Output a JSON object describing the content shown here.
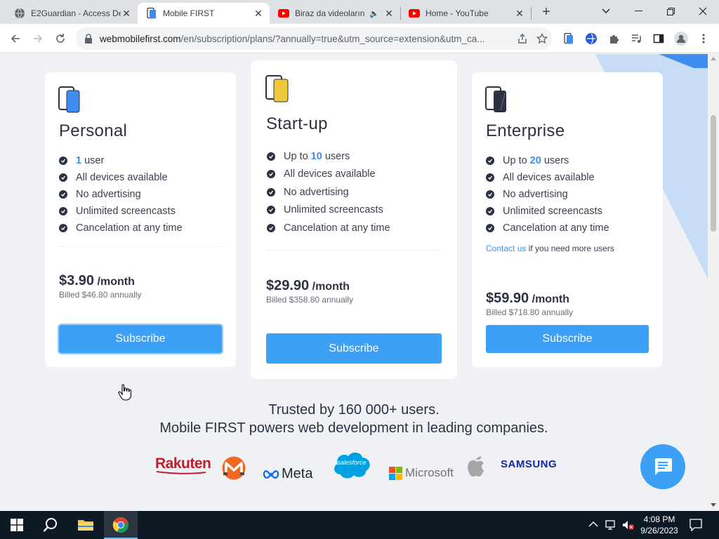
{
  "browser": {
    "tabs": [
      {
        "title": "E2Guardian - Access De",
        "favicon": "globe-icon",
        "active": false
      },
      {
        "title": "Mobile FIRST",
        "favicon": "mobile-first-icon",
        "active": true
      },
      {
        "title": "Biraz da videoların",
        "favicon": "youtube-icon",
        "active": false,
        "audio": true
      },
      {
        "title": "Home - YouTube",
        "favicon": "youtube-icon",
        "active": false
      }
    ],
    "url_host": "webmobilefirst.com",
    "url_path": "/en/subscription/plans/?annually=true&utm_source=extension&utm_ca..."
  },
  "plans": [
    {
      "name": "Personal",
      "icon_color": "#3d8ef0",
      "features": [
        {
          "highlight": "1",
          "text": "user"
        },
        {
          "text": "All devices available"
        },
        {
          "text": "No advertising"
        },
        {
          "text": "Unlimited screencasts"
        },
        {
          "text": "Cancelation at any time"
        }
      ],
      "price": "$3.90",
      "per": "/month",
      "billed": "Billed $46.80 annually",
      "button": "Subscribe"
    },
    {
      "name": "Start-up",
      "icon_color": "#f2c83b",
      "features": [
        {
          "prefix": "Up to",
          "highlight": "10",
          "text": "users"
        },
        {
          "text": "All devices available"
        },
        {
          "text": "No advertising"
        },
        {
          "text": "Unlimited screencasts"
        },
        {
          "text": "Cancelation at any time"
        }
      ],
      "price": "$29.90",
      "per": "/month",
      "billed": "Billed $358.80 annually",
      "button": "Subscribe"
    },
    {
      "name": "Enterprise",
      "icon_color": "#2d3142",
      "features": [
        {
          "prefix": "Up to",
          "highlight": "20",
          "text": "users"
        },
        {
          "text": "All devices available"
        },
        {
          "text": "No advertising"
        },
        {
          "text": "Unlimited screencasts"
        },
        {
          "text": "Cancelation at any time"
        }
      ],
      "contact_link": "Contact us",
      "contact_text": "if you need more users",
      "price": "$59.90",
      "per": "/month",
      "billed": "Billed $718.80 annually",
      "button": "Subscribe"
    }
  ],
  "trusted": {
    "line1": "Trusted by 160 000+ users.",
    "line2": "Mobile FIRST powers web development in leading companies."
  },
  "logos": {
    "rakuten": "Rakuten",
    "meta": "Meta",
    "salesforce": "salesforce",
    "microsoft": "Microsoft",
    "samsung": "SAMSUNG"
  },
  "taskbar": {
    "time": "4:08 PM",
    "date": "9/26/2023"
  },
  "colors": {
    "accent": "#3ca0f6",
    "link": "#3d8ef0",
    "text": "#2d3142",
    "page_bg": "#eff1f5"
  }
}
